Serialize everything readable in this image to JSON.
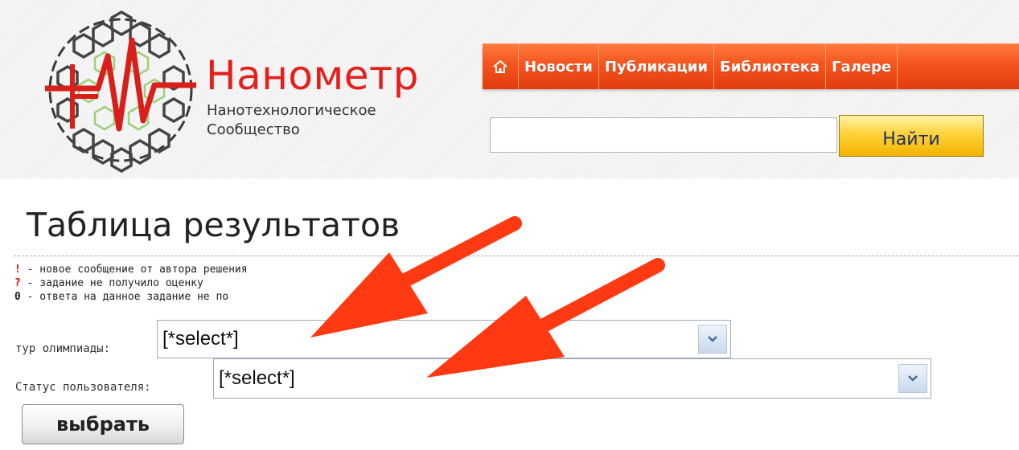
{
  "brand": {
    "title": "Нанометр",
    "subtitle_line1": "Нанотехнологическое",
    "subtitle_line2": "Сообщество"
  },
  "nav": {
    "home_icon": "home-icon",
    "items": [
      "Новости",
      "Публикации",
      "Библиотека",
      "Галере"
    ]
  },
  "search": {
    "value": "",
    "button_label": "Найти"
  },
  "page": {
    "title": "Таблица результатов"
  },
  "legend": [
    {
      "mark": "!",
      "text": " - новое сообщение от автора решения",
      "color": "#e00000"
    },
    {
      "mark": "?",
      "text": " - задание не получило оценку",
      "color": "#e00000"
    },
    {
      "mark": "0",
      "text": " - ответа на данное задание не по",
      "color": "#222222"
    }
  ],
  "filters": {
    "round": {
      "label": "тур олимпиады:",
      "value": "[*select*]"
    },
    "status": {
      "label": "Статус пользователя:",
      "value": "[*select*]"
    }
  },
  "choose_button": "выбрать",
  "colors": {
    "nav_orange": "#f4541e",
    "brand_red": "#e5201c",
    "arrow_red": "#ff3a12",
    "search_yellow": "#ffd23b"
  }
}
